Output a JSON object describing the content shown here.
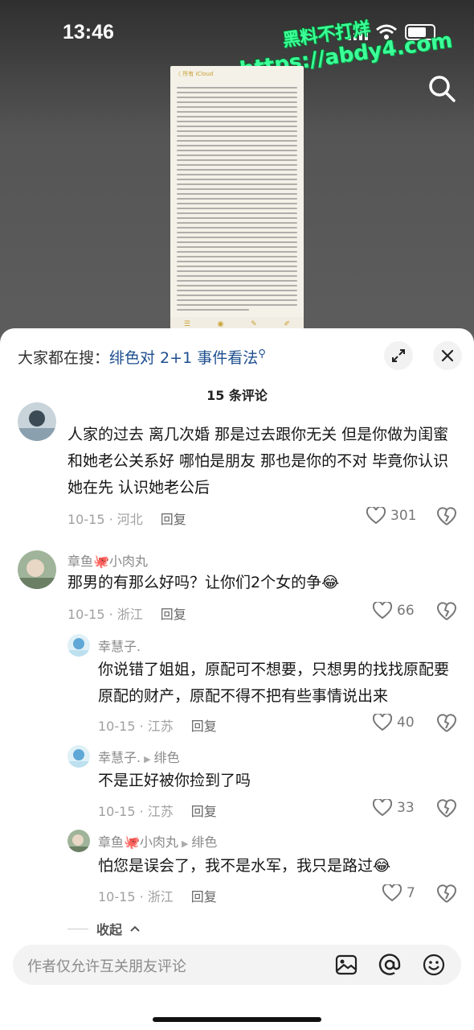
{
  "status_bar": {
    "time": "13:46"
  },
  "watermark": {
    "line1": "黑料不打烊",
    "line2": "https://abdy4.com"
  },
  "preview": {
    "note_header": "〈 所有 iCloud"
  },
  "sheet": {
    "search_hint_prefix": "大家都在搜：",
    "search_hint_keyword": "绯色对 2+1 事件看法",
    "comment_count": "15 条评论"
  },
  "comments": [
    {
      "text": "人家的过去 离几次婚 那是过去跟你无关 但是你做为闺蜜 和她老公关系好 哪怕是朋友 那也是你的不对 毕竟你认识她在先 认识她老公后",
      "date": "10-15",
      "location": "河北",
      "reply_label": "回复",
      "likes": "301"
    },
    {
      "user": "章鱼🐙小肉丸",
      "text": "那男的有那么好吗？让你们2个女的争😂",
      "date": "10-15",
      "location": "浙江",
      "reply_label": "回复",
      "likes": "66"
    },
    {
      "user": "幸慧子.",
      "text": "你说错了姐姐，原配可不想要，只想男的找找原配要原配的财产，原配不得不把有些事情说出来",
      "date": "10-15",
      "location": "江苏",
      "reply_label": "回复",
      "likes": "40"
    },
    {
      "user": "幸慧子.",
      "reply_to": "绯色",
      "text": "不是正好被你捡到了吗",
      "date": "10-15",
      "location": "江苏",
      "reply_label": "回复",
      "likes": "33"
    },
    {
      "user": "章鱼🐙小肉丸",
      "reply_to": "绯色",
      "text": "怕您是误会了，我不是水军，我只是路过😂",
      "date": "10-15",
      "location": "浙江",
      "reply_label": "回复",
      "likes": "7"
    }
  ],
  "collapse_label": "收起",
  "input": {
    "placeholder": "作者仅允许互关朋友评论"
  },
  "icons": [
    "search-icon",
    "expand-icon",
    "close-icon",
    "heart-icon",
    "broken-heart-icon",
    "image-icon",
    "at-icon",
    "emoji-icon"
  ]
}
